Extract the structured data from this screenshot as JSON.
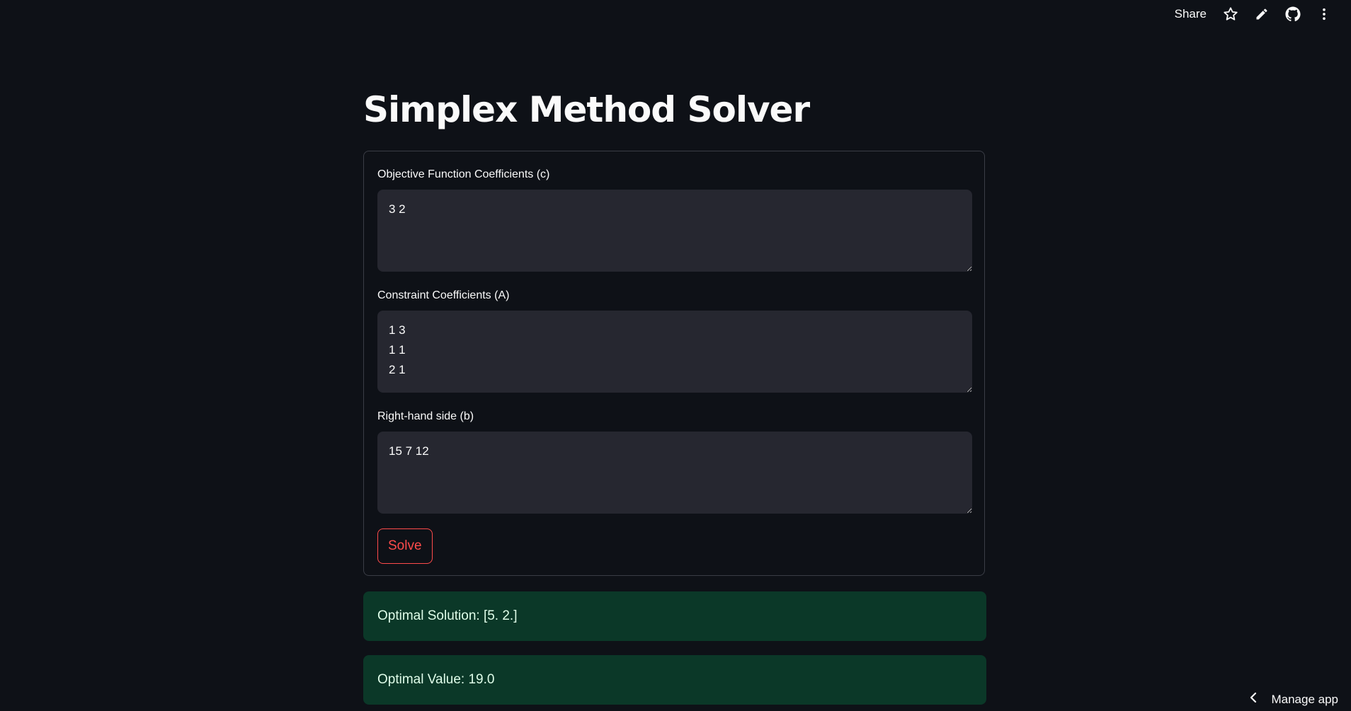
{
  "toolbar": {
    "share_label": "Share",
    "icons": [
      "star-icon",
      "pencil-icon",
      "github-icon",
      "more-vertical-icon"
    ]
  },
  "page": {
    "title": "Simplex Method Solver"
  },
  "form": {
    "objective_label": "Objective Function Coefficients (c)",
    "objective_value": "3 2",
    "constraints_label": "Constraint Coefficients (A)",
    "constraints_value": "1 3\n1 1\n2 1",
    "rhs_label": "Right-hand side (b)",
    "rhs_value": "15 7 12",
    "solve_label": "Solve"
  },
  "results": {
    "solution_text": "Optimal Solution: [5. 2.]",
    "value_text": "Optimal Value: 19.0"
  },
  "footer": {
    "manage_app_label": "Manage app"
  },
  "colors": {
    "background": "#0e1117",
    "input_bg": "#262730",
    "accent": "#ff4b4b",
    "success_bg": "#0b3828",
    "success_text": "#dffde9"
  }
}
